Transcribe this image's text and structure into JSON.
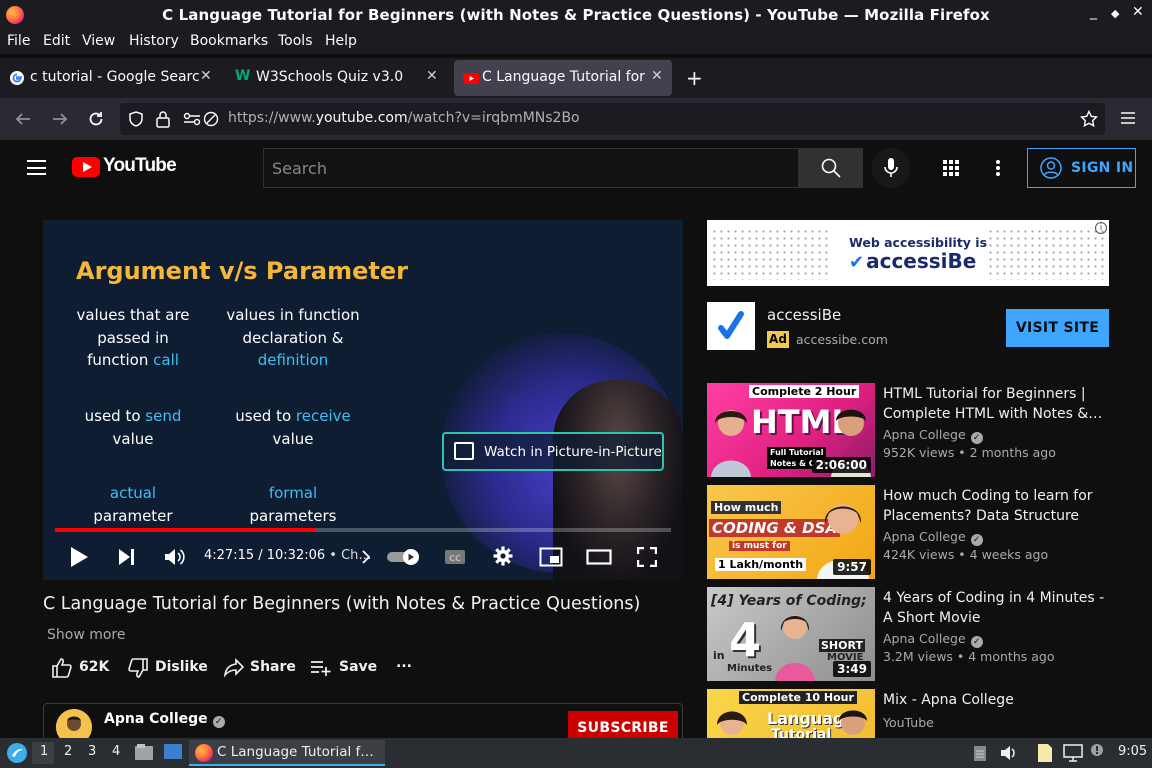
{
  "window": {
    "title": "C Language Tutorial for Beginners (with Notes & Practice Questions) - YouTube — Mozilla Firefox",
    "controls": [
      "_",
      "◆",
      "✕"
    ]
  },
  "menu": [
    "File",
    "Edit",
    "View",
    "History",
    "Bookmarks",
    "Tools",
    "Help"
  ],
  "tabs": [
    {
      "label": "c tutorial - Google Search",
      "favicon": "google-icon",
      "active": false
    },
    {
      "label": "W3Schools Quiz v3.0",
      "favicon": "w3schools-icon",
      "active": false
    },
    {
      "label": "C Language Tutorial for B",
      "favicon": "youtube-icon",
      "active": true
    }
  ],
  "newtab_label": "+",
  "urlbar": {
    "prefix": "https://www.",
    "domain": "youtube.com",
    "path": "/watch?v=irqbmMNs2Bo"
  },
  "youtube": {
    "logo_text": "YouTube",
    "search_placeholder": "Search",
    "signin_label": "SIGN IN"
  },
  "video": {
    "slide_title": "Argument v/s Parameter",
    "left_col": {
      "line1a": "values that are",
      "line1b": "passed in",
      "line1c": "function ",
      "line1c_hl": "call",
      "line2a": "used to ",
      "line2a_hl": "send",
      "line2b": "value",
      "line3a": "actual",
      "line3b": "parameter"
    },
    "right_col": {
      "line1a": "values in function",
      "line1b": "declaration &",
      "line1c_hl": "definition",
      "line2a": "used to ",
      "line2a_hl": "receive",
      "line2b": "value",
      "line3a": "formal",
      "line3b": "parameters"
    },
    "pip_label": "Watch in Picture-in-Picture",
    "time": "4:27:15 / 10:32:06",
    "chapter": " • Ch…",
    "progress_fraction": 0.4224,
    "title": "C Language Tutorial for Beginners (with Notes & Practice Questions)",
    "show_more": "Show more",
    "likes": "62K",
    "dislike_label": "Dislike",
    "share_label": "Share",
    "save_label": "Save",
    "more_label": "...",
    "channel_name": "Apna College",
    "subscribe_label": "SUBSCRIBE"
  },
  "ad": {
    "banner_line1": "Web accessibility is",
    "banner_line2": "accessiBe",
    "info": "i",
    "name": "accessiBe",
    "tag": "Ad",
    "domain": "accessibe.com",
    "visit_label": "VISIT SITE"
  },
  "recommendations": [
    {
      "title": "HTML Tutorial for Beginners | Complete HTML with Notes &…",
      "channel": "Apna College",
      "meta": "952K views • 2 months ago",
      "duration": "2:06:00",
      "thumb_text1": "Complete 2 Hour",
      "thumb_text2": "HTML",
      "thumb_text3": "Full Tutorial",
      "thumb_text4": "Notes & Code",
      "verified": true
    },
    {
      "title": "How much Coding to learn for Placements? Data Structure &…",
      "channel": "Apna College",
      "meta": "424K views • 4 weeks ago",
      "duration": "9:57",
      "thumb_text1": "How much",
      "thumb_text2": "CODING & DSA",
      "thumb_text3": "is must for",
      "thumb_text4": "1 Lakh/month",
      "verified": true
    },
    {
      "title": "4 Years of Coding in 4 Minutes - A Short Movie",
      "channel": "Apna College",
      "meta": "3.2M views • 4 months ago",
      "duration": "3:49",
      "thumb_text1": "[4] Years of Coding;",
      "thumb_text2": "4",
      "thumb_text3": "in",
      "thumb_text4": "Minutes",
      "thumb_text5": "SHORT",
      "thumb_text6": "MOVIE",
      "verified": true
    },
    {
      "title": "Mix - Apna College",
      "channel": "YouTube",
      "meta": "",
      "duration": "",
      "thumb_text1": "Complete 10 Hour",
      "thumb_text2": "Language",
      "thumb_text3": "Tutorial",
      "thumb_text4": "",
      "verified": false
    }
  ],
  "taskbar": {
    "workspaces": [
      "1",
      "2",
      "3",
      "4"
    ],
    "task_label": "C Language Tutorial f…",
    "clock": "9:05"
  }
}
